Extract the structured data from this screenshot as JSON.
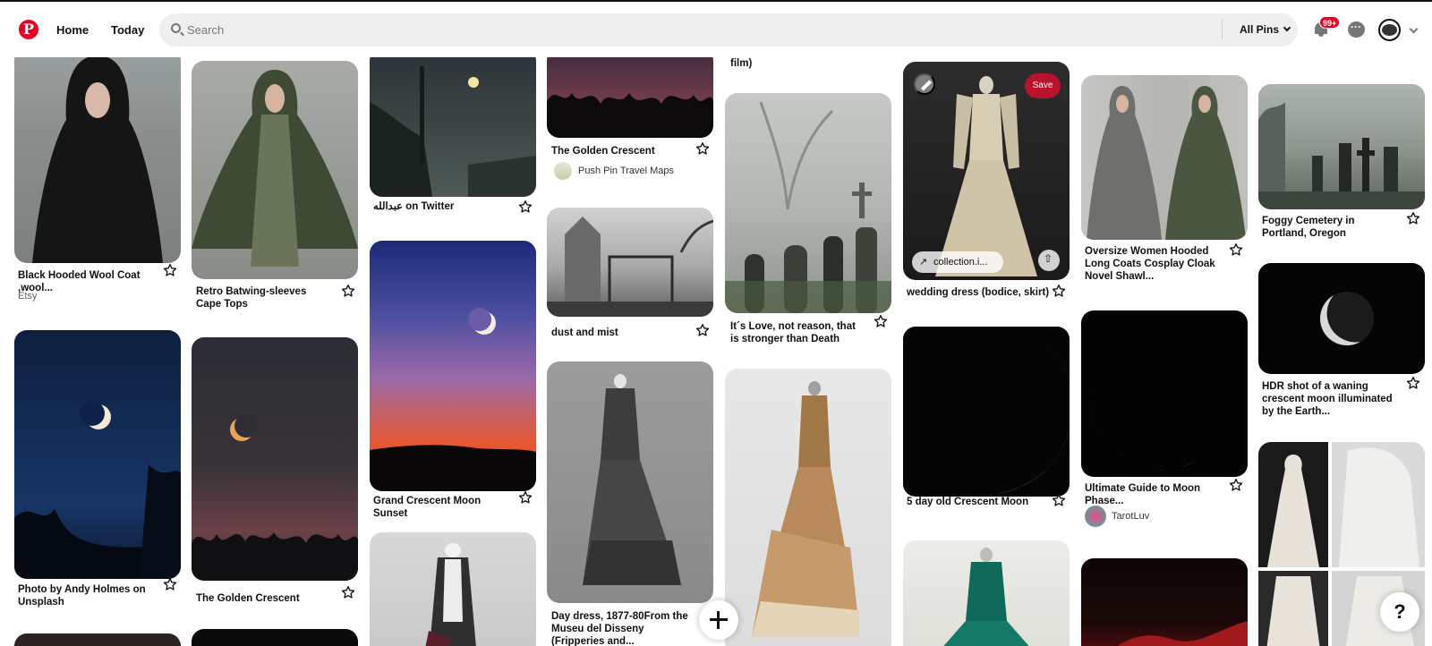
{
  "header": {
    "logo_text": "P",
    "nav": {
      "home": "Home",
      "today": "Today"
    },
    "search": {
      "placeholder": "Search",
      "value": ""
    },
    "filter": {
      "label": "All Pins"
    },
    "notifications": {
      "badge": "99+"
    }
  },
  "pins": [
    {
      "title": "Black Hooded Wool Coat ,wool...",
      "source": "Etsy"
    },
    {
      "title": "Photo by Andy Holmes on Unsplash"
    },
    {
      "title": "Retro Batwing-sleeves Cape Tops"
    },
    {
      "title": "The Golden Crescent"
    },
    {
      "title": "عبدالله on Twitter"
    },
    {
      "title": "Grand Crescent Moon Sunset"
    },
    {
      "title": "The Golden Crescent",
      "source": "Push Pin Travel Maps"
    },
    {
      "title": "dust and mist"
    },
    {
      "title": "Day dress, 1877-80From the Museu del Disseny (Fripperies and..."
    },
    {
      "title": "film)"
    },
    {
      "title": "It´s Love, not reason, that is stronger than Death"
    },
    {
      "title": "wedding dress (bodice, skirt)",
      "save_label": "Save",
      "link_label": "collection.i..."
    },
    {
      "title": "5 day old Crescent Moon"
    },
    {
      "title": "Oversize Women Hooded Long Coats Cosplay Cloak Novel Shawl..."
    },
    {
      "title": "Ultimate Guide to Moon Phase...",
      "source": "TarotLuv"
    },
    {
      "title": "Foggy Cemetery in Portland, Oregon"
    },
    {
      "title": "HDR shot of a waning crescent moon illuminated by the Earth..."
    }
  ],
  "help": {
    "label": "?"
  },
  "colors": {
    "brand": "#e60023",
    "save": "#b8122c"
  }
}
